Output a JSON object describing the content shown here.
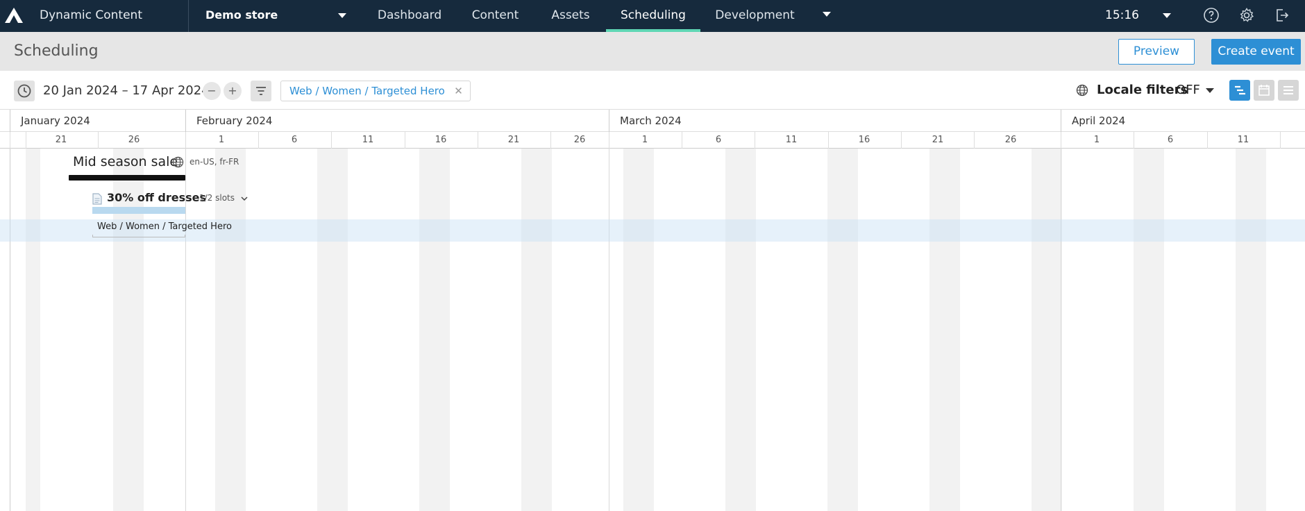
{
  "nav": {
    "app_name": "Dynamic Content",
    "store": "Demo store",
    "tabs": [
      {
        "label": "Dashboard"
      },
      {
        "label": "Content"
      },
      {
        "label": "Assets"
      },
      {
        "label": "Scheduling",
        "active": true
      },
      {
        "label": "Development"
      }
    ],
    "time": "15:16",
    "icons": [
      "help-icon",
      "settings-icon",
      "logout-icon"
    ]
  },
  "titlebar": {
    "title": "Scheduling",
    "preview_label": "Preview",
    "create_label": "Create event"
  },
  "toolbar": {
    "date_range": "20 Jan 2024 – 17 Apr 2024",
    "zoom_out": "−",
    "zoom_in": "+",
    "filter_chip": "Web / Women / Targeted Hero",
    "locale_label": "Locale filters",
    "locale_value": "OFF"
  },
  "timeline": {
    "months": [
      "January 2024",
      "February 2024",
      "March 2024",
      "April 2024"
    ],
    "day_labels": [
      "21",
      "26",
      "1",
      "6",
      "11",
      "16",
      "21",
      "26",
      "1",
      "6",
      "11",
      "16",
      "21",
      "26",
      "1",
      "6",
      "11"
    ]
  },
  "event": {
    "title": "Mid season sale",
    "locales": "en-US, fr-FR",
    "item_title": "30% off dresses",
    "slots": "1/2 slots",
    "slot_label": "Web / Women / Targeted Hero"
  },
  "colors": {
    "nav_bg": "#162a3d",
    "accent": "#2d8fd5",
    "active_tab": "#5fd6b4"
  }
}
